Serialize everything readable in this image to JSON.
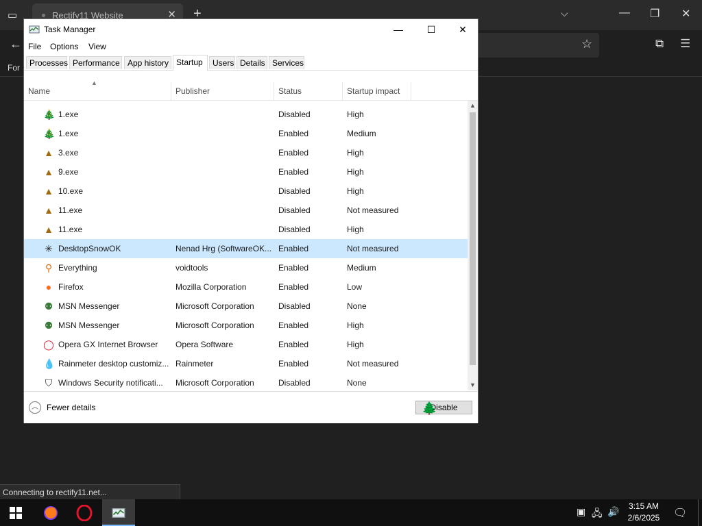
{
  "browser": {
    "tab_title": "Rectify11 Website",
    "tab_close": "✕",
    "new_tab": "+",
    "bookmark_text": "For",
    "status_text": "Connecting to rectify11.net..."
  },
  "taskmgr": {
    "title": "Task Manager",
    "menu": [
      "File",
      "Options",
      "View"
    ],
    "tabs": [
      "Processes",
      "Performance",
      "App history",
      "Startup",
      "Users",
      "Details",
      "Services"
    ],
    "active_tab": "Startup",
    "columns": [
      "Name",
      "Publisher",
      "Status",
      "Startup impact"
    ],
    "rows": [
      {
        "icon": "tree-green-icon",
        "name": "1.exe",
        "publisher": "",
        "status": "Disabled",
        "impact": "High"
      },
      {
        "icon": "tree-green-icon",
        "name": "1.exe",
        "publisher": "",
        "status": "Enabled",
        "impact": "Medium"
      },
      {
        "icon": "tree-small-icon",
        "name": "3.exe",
        "publisher": "",
        "status": "Enabled",
        "impact": "High"
      },
      {
        "icon": "tree-small-icon",
        "name": "9.exe",
        "publisher": "",
        "status": "Enabled",
        "impact": "High"
      },
      {
        "icon": "tree-small-icon",
        "name": "10.exe",
        "publisher": "",
        "status": "Disabled",
        "impact": "High"
      },
      {
        "icon": "tree-small-icon",
        "name": "11.exe",
        "publisher": "",
        "status": "Disabled",
        "impact": "Not measured"
      },
      {
        "icon": "tree-small-icon",
        "name": "11.exe",
        "publisher": "",
        "status": "Disabled",
        "impact": "High"
      },
      {
        "icon": "snowflake-icon",
        "name": "DesktopSnowOK",
        "publisher": "Nenad Hrg (SoftwareOK...",
        "status": "Enabled",
        "impact": "Not measured",
        "selected": true
      },
      {
        "icon": "magnifier-icon",
        "name": "Everything",
        "publisher": "voidtools",
        "status": "Enabled",
        "impact": "Medium"
      },
      {
        "icon": "firefox-icon",
        "name": "Firefox",
        "publisher": "Mozilla Corporation",
        "status": "Enabled",
        "impact": "Low"
      },
      {
        "icon": "msn-icon",
        "name": "MSN Messenger",
        "publisher": "Microsoft Corporation",
        "status": "Disabled",
        "impact": "None"
      },
      {
        "icon": "msn-icon",
        "name": "MSN Messenger",
        "publisher": "Microsoft Corporation",
        "status": "Enabled",
        "impact": "High"
      },
      {
        "icon": "opera-icon",
        "name": "Opera GX Internet Browser",
        "publisher": "Opera Software",
        "status": "Enabled",
        "impact": "High"
      },
      {
        "icon": "raindrop-icon",
        "name": "Rainmeter desktop customiz...",
        "publisher": "Rainmeter",
        "status": "Enabled",
        "impact": "Not measured"
      },
      {
        "icon": "shield-icon",
        "name": "Windows Security notificati...",
        "publisher": "Microsoft Corporation",
        "status": "Disabled",
        "impact": "None"
      }
    ],
    "fewer_details": "Fewer details",
    "disable_button": "Disable"
  },
  "taskbar": {
    "time": "3:15 AM",
    "date": "2/6/2025"
  },
  "colors": {
    "selection": "#cce8ff",
    "taskbar": "#101010",
    "accent": "#7ab8ff"
  }
}
